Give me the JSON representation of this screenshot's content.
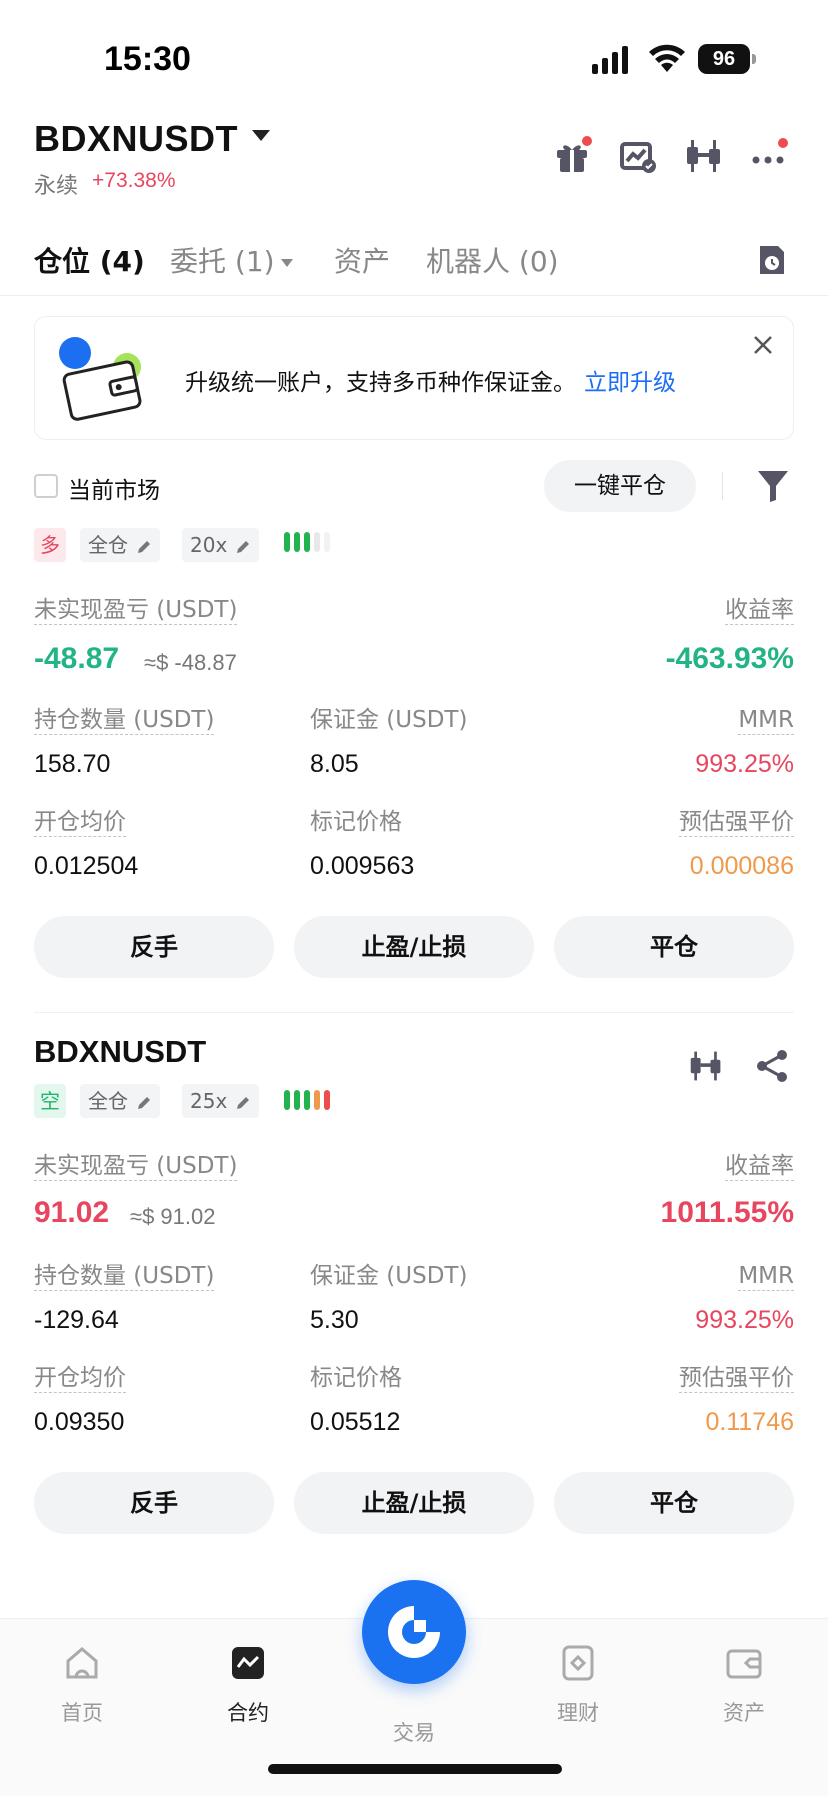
{
  "status_bar": {
    "time": "15:30",
    "battery": "96"
  },
  "header": {
    "symbol": "BDXNUSDT",
    "contract_type": "永续",
    "change": "+73.38%"
  },
  "tabs": [
    {
      "label": "仓位 (4)"
    },
    {
      "label": "委托 (1)"
    },
    {
      "label": "资产"
    },
    {
      "label": "机器人 (0)"
    }
  ],
  "banner": {
    "text": "升级统一账户，支持多币种作保证金。",
    "link": "立即升级"
  },
  "filter": {
    "checkbox_label": "当前市场",
    "close_all": "一键平仓"
  },
  "labels": {
    "upnl": "未实现盈亏 (USDT)",
    "roi": "收益率",
    "size": "持仓数量 (USDT)",
    "margin": "保证金 (USDT)",
    "mmr": "MMR",
    "entry": "开仓均价",
    "mark": "标记价格",
    "liq": "预估强平价"
  },
  "actions": {
    "reverse": "反手",
    "tpsl": "止盈/止损",
    "close": "平仓"
  },
  "positions": [
    {
      "side": "多",
      "margin_mode": "全仓",
      "leverage": "20x",
      "adl_level": 3,
      "upnl": "-48.87",
      "upnl_usd": "≈$ -48.87",
      "roi": "-463.93%",
      "size": "158.70",
      "margin": "8.05",
      "mmr": "993.25%",
      "entry": "0.012504",
      "mark": "0.009563",
      "liq": "0.000086"
    },
    {
      "symbol": "BDXNUSDT",
      "side": "空",
      "margin_mode": "全仓",
      "leverage": "25x",
      "adl_level": 5,
      "upnl": "91.02",
      "upnl_usd": "≈$ 91.02",
      "roi": "1011.55%",
      "size": "-129.64",
      "margin": "5.30",
      "mmr": "993.25%",
      "entry": "0.09350",
      "mark": "0.05512",
      "liq": "0.11746"
    }
  ],
  "bottom_nav": [
    {
      "label": "首页",
      "icon": "home-icon"
    },
    {
      "label": "合约",
      "icon": "futures-icon"
    },
    {
      "label": "交易",
      "icon": "trade-icon"
    },
    {
      "label": "理财",
      "icon": "earn-icon"
    },
    {
      "label": "资产",
      "icon": "wallet-icon"
    }
  ],
  "colors": {
    "accent": "#1a72f0",
    "up": "#22b386",
    "down": "#e8455f",
    "liq": "#f0994a"
  }
}
